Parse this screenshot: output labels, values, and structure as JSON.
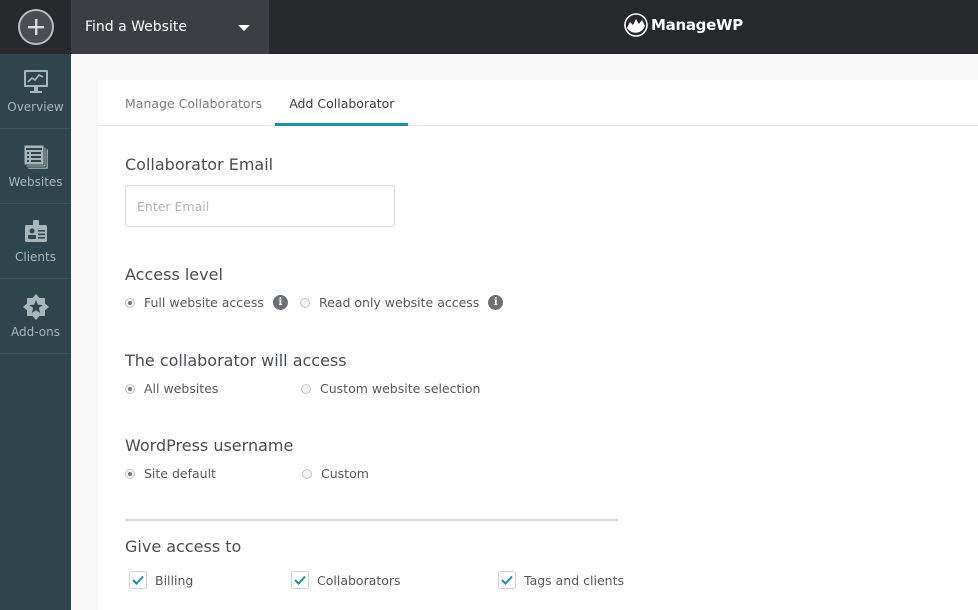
{
  "topbar": {
    "add_button_label": "+",
    "find_website_label": "Find a Website",
    "logo_text": "ManageWP"
  },
  "sidebar": {
    "items": [
      {
        "label": "Overview",
        "icon": "monitor-chart-icon"
      },
      {
        "label": "Websites",
        "icon": "website-list-icon"
      },
      {
        "label": "Clients",
        "icon": "id-badge-icon"
      },
      {
        "label": "Add-ons",
        "icon": "star-badge-icon"
      }
    ]
  },
  "tabs": [
    {
      "label": "Manage Collaborators",
      "active": false
    },
    {
      "label": "Add Collaborator",
      "active": true
    }
  ],
  "form": {
    "email": {
      "label": "Collaborator Email",
      "placeholder": "Enter Email",
      "value": ""
    },
    "access_level": {
      "label": "Access level",
      "options": [
        {
          "label": "Full website access",
          "checked": true,
          "info": true
        },
        {
          "label": "Read only website access",
          "checked": false,
          "info": true
        }
      ]
    },
    "will_access": {
      "label": "The collaborator will access",
      "options": [
        {
          "label": "All websites",
          "checked": true
        },
        {
          "label": "Custom website selection",
          "checked": false
        }
      ]
    },
    "wp_username": {
      "label": "WordPress username",
      "options": [
        {
          "label": "Site default",
          "checked": true
        },
        {
          "label": "Custom",
          "checked": false
        }
      ]
    },
    "give_access": {
      "label": "Give access to",
      "options": [
        {
          "label": "Billing",
          "checked": true
        },
        {
          "label": "Collaborators",
          "checked": true
        },
        {
          "label": "Tags and clients",
          "checked": true
        }
      ]
    }
  },
  "colors": {
    "accent": "#1a8fae",
    "topbar": "#26282c",
    "sidebar": "#2e454c"
  }
}
